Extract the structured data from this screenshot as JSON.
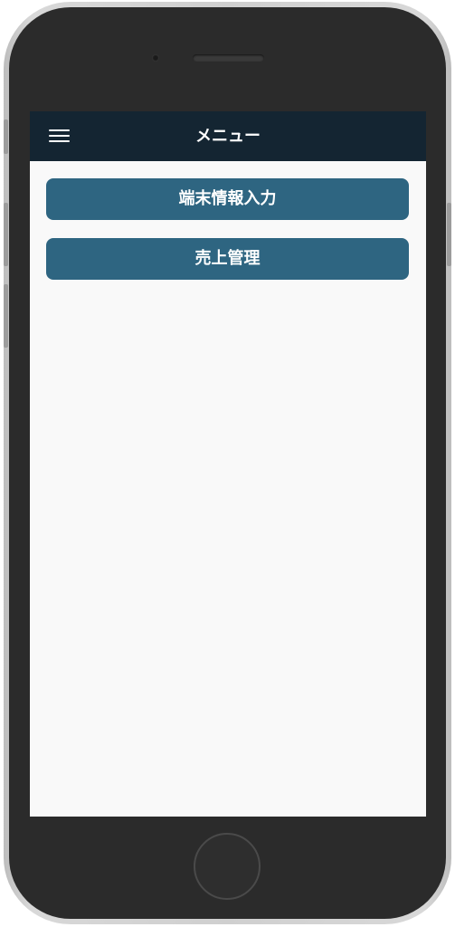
{
  "header": {
    "title": "メニュー",
    "menu_icon": "hamburger-menu-icon"
  },
  "menu": {
    "items": [
      {
        "label": "端末情報入力"
      },
      {
        "label": "売上管理"
      }
    ]
  },
  "colors": {
    "header_bg": "#142532",
    "button_bg": "#2e6581",
    "screen_bg": "#f9f9f9",
    "text": "#ffffff"
  }
}
